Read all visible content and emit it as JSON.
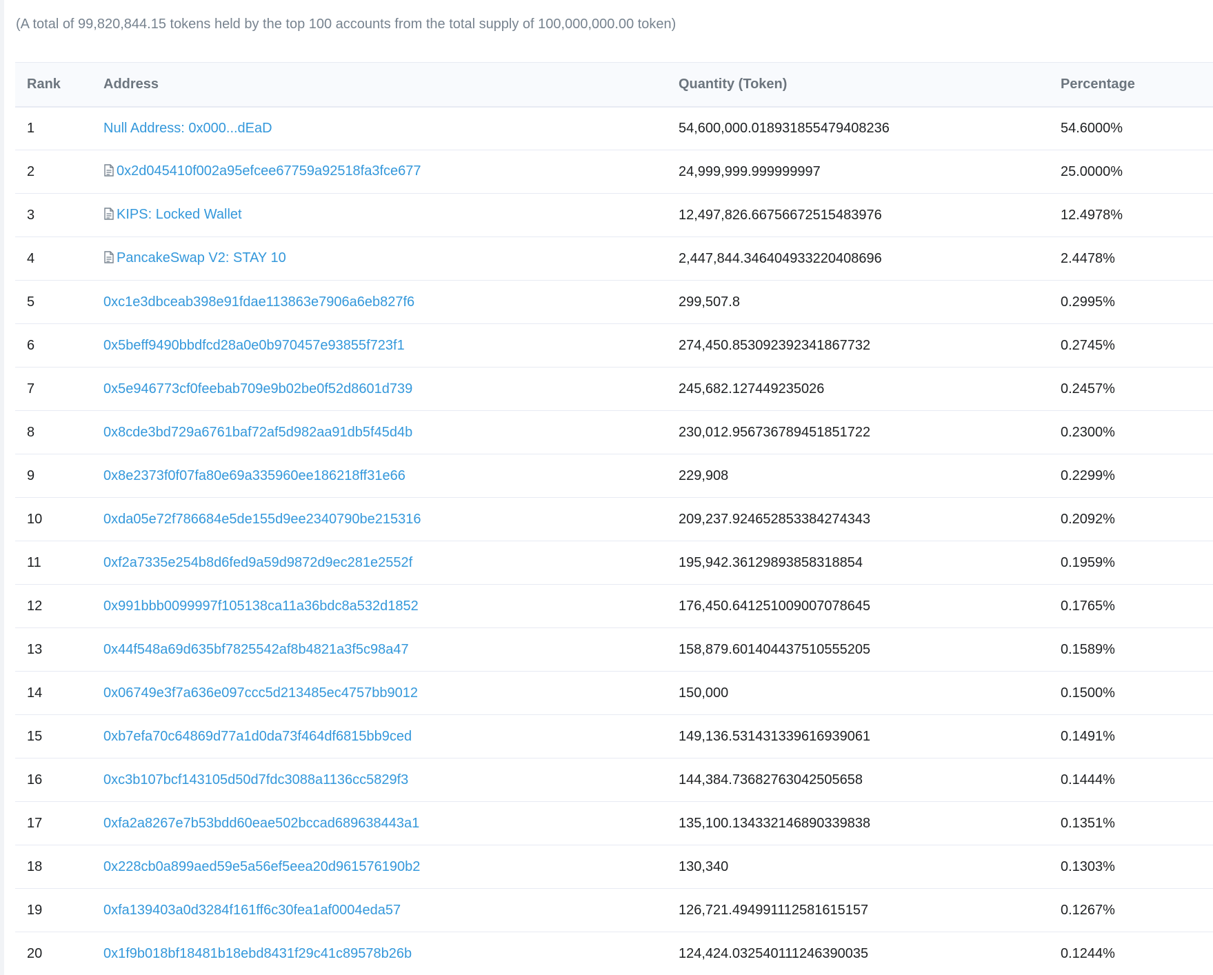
{
  "summary_text": "(A total of 99,820,844.15 tokens held by the top 100 accounts from the total supply of 100,000,000.00 token)",
  "icons": {
    "contract": "file-text-icon"
  },
  "colors": {
    "link": "#3498db",
    "text": "#1e2022",
    "muted": "#77838f",
    "header_bg": "#f8fafd",
    "border": "#e7eaf3"
  },
  "table": {
    "headers": {
      "rank": "Rank",
      "address": "Address",
      "quantity": "Quantity (Token)",
      "percentage": "Percentage"
    },
    "rows": [
      {
        "rank": "1",
        "address": "Null Address: 0x000...dEaD",
        "contract": false,
        "quantity": "54,600,000.018931855479408236",
        "percentage": "54.6000%"
      },
      {
        "rank": "2",
        "address": "0x2d045410f002a95efcee67759a92518fa3fce677",
        "contract": true,
        "quantity": "24,999,999.999999997",
        "percentage": "25.0000%"
      },
      {
        "rank": "3",
        "address": "KIPS: Locked Wallet",
        "contract": true,
        "quantity": "12,497,826.66756672515483976",
        "percentage": "12.4978%"
      },
      {
        "rank": "4",
        "address": "PancakeSwap V2: STAY 10",
        "contract": true,
        "quantity": "2,447,844.346404933220408696",
        "percentage": "2.4478%"
      },
      {
        "rank": "5",
        "address": "0xc1e3dbceab398e91fdae113863e7906a6eb827f6",
        "contract": false,
        "quantity": "299,507.8",
        "percentage": "0.2995%"
      },
      {
        "rank": "6",
        "address": "0x5beff9490bbdfcd28a0e0b970457e93855f723f1",
        "contract": false,
        "quantity": "274,450.853092392341867732",
        "percentage": "0.2745%"
      },
      {
        "rank": "7",
        "address": "0x5e946773cf0feebab709e9b02be0f52d8601d739",
        "contract": false,
        "quantity": "245,682.127449235026",
        "percentage": "0.2457%"
      },
      {
        "rank": "8",
        "address": "0x8cde3bd729a6761baf72af5d982aa91db5f45d4b",
        "contract": false,
        "quantity": "230,012.956736789451851722",
        "percentage": "0.2300%"
      },
      {
        "rank": "9",
        "address": "0x8e2373f0f07fa80e69a335960ee186218ff31e66",
        "contract": false,
        "quantity": "229,908",
        "percentage": "0.2299%"
      },
      {
        "rank": "10",
        "address": "0xda05e72f786684e5de155d9ee2340790be215316",
        "contract": false,
        "quantity": "209,237.924652853384274343",
        "percentage": "0.2092%"
      },
      {
        "rank": "11",
        "address": "0xf2a7335e254b8d6fed9a59d9872d9ec281e2552f",
        "contract": false,
        "quantity": "195,942.36129893858318854",
        "percentage": "0.1959%"
      },
      {
        "rank": "12",
        "address": "0x991bbb0099997f105138ca11a36bdc8a532d1852",
        "contract": false,
        "quantity": "176,450.641251009007078645",
        "percentage": "0.1765%"
      },
      {
        "rank": "13",
        "address": "0x44f548a69d635bf7825542af8b4821a3f5c98a47",
        "contract": false,
        "quantity": "158,879.601404437510555205",
        "percentage": "0.1589%"
      },
      {
        "rank": "14",
        "address": "0x06749e3f7a636e097ccc5d213485ec4757bb9012",
        "contract": false,
        "quantity": "150,000",
        "percentage": "0.1500%"
      },
      {
        "rank": "15",
        "address": "0xb7efa70c64869d77a1d0da73f464df6815bb9ced",
        "contract": false,
        "quantity": "149,136.531431339616939061",
        "percentage": "0.1491%"
      },
      {
        "rank": "16",
        "address": "0xc3b107bcf143105d50d7fdc3088a1136cc5829f3",
        "contract": false,
        "quantity": "144,384.73682763042505658",
        "percentage": "0.1444%"
      },
      {
        "rank": "17",
        "address": "0xfa2a8267e7b53bdd60eae502bccad689638443a1",
        "contract": false,
        "quantity": "135,100.134332146890339838",
        "percentage": "0.1351%"
      },
      {
        "rank": "18",
        "address": "0x228cb0a899aed59e5a56ef5eea20d961576190b2",
        "contract": false,
        "quantity": "130,340",
        "percentage": "0.1303%"
      },
      {
        "rank": "19",
        "address": "0xfa139403a0d3284f161ff6c30fea1af0004eda57",
        "contract": false,
        "quantity": "126,721.494991112581615157",
        "percentage": "0.1267%"
      },
      {
        "rank": "20",
        "address": "0x1f9b018bf18481b18ebd8431f29c41c89578b26b",
        "contract": false,
        "quantity": "124,424.032540111246390035",
        "percentage": "0.1244%"
      }
    ]
  }
}
